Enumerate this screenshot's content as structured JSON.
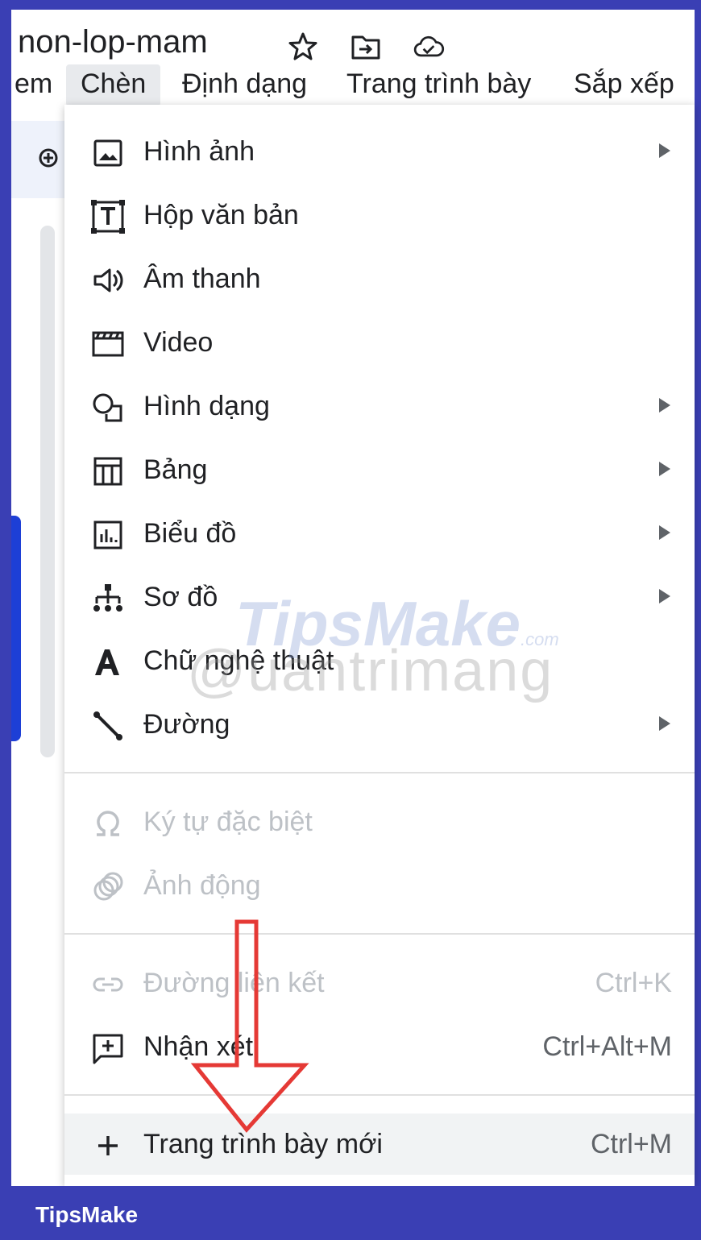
{
  "doc_title": "non-lop-mam",
  "title_icons": [
    "star-icon",
    "move-to-folder-icon",
    "cloud-saved-icon"
  ],
  "menubar": {
    "items": [
      "em",
      "Chèn",
      "Định dạng",
      "Trang trình bày",
      "Sắp xếp"
    ],
    "active": "Chèn"
  },
  "dropdown": {
    "group1": [
      {
        "label": "Hình ảnh",
        "icon": "image-icon",
        "submenu": true
      },
      {
        "label": "Hộp văn bản",
        "icon": "text-box-icon",
        "submenu": false
      },
      {
        "label": "Âm thanh",
        "icon": "audio-icon",
        "submenu": false
      },
      {
        "label": "Video",
        "icon": "video-icon",
        "submenu": false
      },
      {
        "label": "Hình dạng",
        "icon": "shape-icon",
        "submenu": true
      },
      {
        "label": "Bảng",
        "icon": "table-icon",
        "submenu": true
      },
      {
        "label": "Biểu đồ",
        "icon": "chart-icon",
        "submenu": true
      },
      {
        "label": "Sơ đồ",
        "icon": "diagram-icon",
        "submenu": true
      },
      {
        "label": "Chữ nghệ thuật",
        "icon": "word-art-icon",
        "submenu": false
      },
      {
        "label": "Đường",
        "icon": "line-icon",
        "submenu": true
      }
    ],
    "group2": [
      {
        "label": "Ký tự đặc biệt",
        "icon": "omega-icon",
        "disabled": true
      },
      {
        "label": "Ảnh động",
        "icon": "animation-icon",
        "disabled": true
      }
    ],
    "group3": [
      {
        "label": "Đường liên kết",
        "icon": "link-icon",
        "shortcut": "Ctrl+K",
        "disabled": true
      },
      {
        "label": "Nhận xét",
        "icon": "add-comment-icon",
        "shortcut": "Ctrl+Alt+M",
        "disabled": false
      }
    ],
    "group4": [
      {
        "label": "Trang trình bày mới",
        "icon": "plus-icon",
        "shortcut": "Ctrl+M",
        "highlighted": true
      }
    ]
  },
  "watermark": {
    "line1": "TipsMake",
    "line1_suffix": ".com",
    "line2": "@uantrimang"
  },
  "footer": {
    "brand": "TipsMake"
  },
  "colors": {
    "frame": "#3a3fb4",
    "annotation_arrow": "#e53935",
    "hover": "#f1f3f4"
  }
}
